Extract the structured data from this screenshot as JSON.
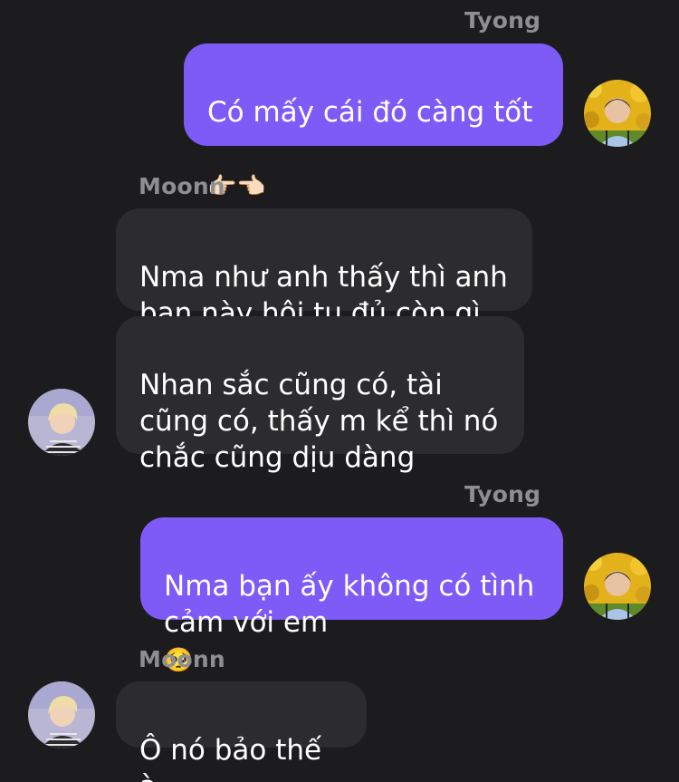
{
  "conversation": {
    "messages": [
      {
        "sender": "Tyong",
        "direction": "outgoing",
        "text": "Có mấy cái đó càng tốt",
        "emoji": "👉🏻👈🏻"
      },
      {
        "sender": "Moonn",
        "direction": "incoming",
        "text": "Nma như anh thấy thì anh\nbạn này hội tụ đủ còn gì"
      },
      {
        "sender": "Moonn",
        "direction": "incoming",
        "text": "Nhan sắc cũng có, tài\ncũng có, thấy m kể thì nó\nchắc cũng dịu dàng"
      },
      {
        "sender": "Tyong",
        "direction": "outgoing",
        "text": "Nma bạn ấy không có tình\ncảm với em",
        "emoji": "🥺"
      },
      {
        "sender": "Moonn",
        "direction": "incoming",
        "text": "Ô nó bảo thế à"
      }
    ]
  },
  "colors": {
    "background": "#1c1c1e",
    "outgoing_bubble": "#7e5bf6",
    "incoming_bubble": "#2c2c2e",
    "sender_name": "#8e8e93",
    "message_text": "#ffffff"
  },
  "icons": {
    "tyong_avatar": "avatar-tyong-icon",
    "moonn_avatar": "avatar-moonn-icon"
  }
}
